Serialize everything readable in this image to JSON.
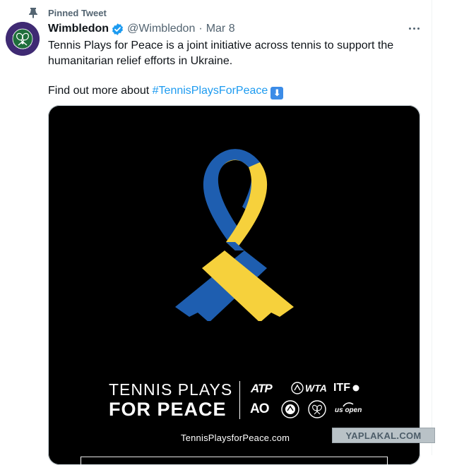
{
  "pinned": {
    "label": "Pinned Tweet",
    "icon": "pin-icon"
  },
  "author": {
    "display_name": "Wimbledon",
    "handle": "@Wimbledon",
    "separator": "·",
    "date": "Mar 8",
    "verified_icon": "verified-badge-icon",
    "avatar": {
      "text_top": "THE CHAMPIONSHIPS",
      "text_bottom": "WIMBLEDON",
      "bg_color": "#3f2a73",
      "accent_color": "#1f6e3b"
    }
  },
  "tweet": {
    "text": "Tennis Plays for Peace is a joint initiative across tennis to support the humanitarian relief efforts in Ukraine.",
    "find_out_prefix": "Find out more about",
    "hashtag": "#TennisPlaysForPeace",
    "emoji": "⬇",
    "emoji_name": "down-arrow-emoji"
  },
  "media": {
    "line1": "TENNIS PLAYS",
    "line2": "FOR PEACE",
    "logos": {
      "atp": "ATP",
      "wta": "WTA",
      "itf": "ITF",
      "ao": "AO",
      "usopen": "us open"
    },
    "url": "TennisPlaysforPeace.com",
    "ribbon_colors": {
      "blue": "#1e5eb0",
      "yellow": "#f6d13c"
    }
  },
  "watermark": "YAPLAKAL.COM",
  "colors": {
    "hashtag": "#1d9bf0",
    "secondary_text": "#536471",
    "verified": "#1d9bf0"
  }
}
